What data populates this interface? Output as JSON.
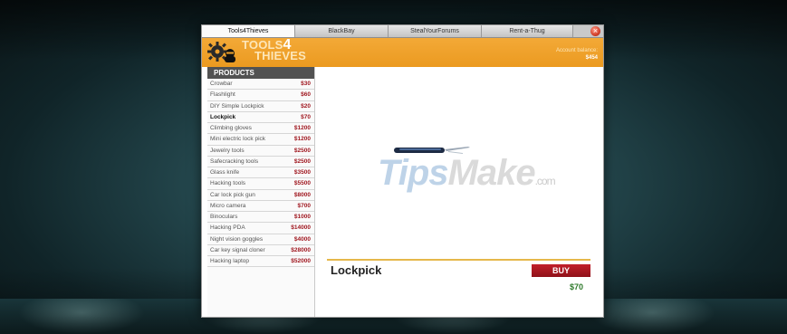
{
  "tabs": [
    {
      "label": "Tools4Thieves"
    },
    {
      "label": "BlackBay"
    },
    {
      "label": "StealYourForums"
    },
    {
      "label": "Rent-a-Thug"
    }
  ],
  "header": {
    "logo_line1": "TOOLS",
    "logo_number": "4",
    "logo_line2": "THIEVES",
    "account_label": "Account balance:",
    "account_value": "$454"
  },
  "sidebar": {
    "title": "PRODUCTS",
    "items": [
      {
        "name": "Crowbar",
        "price": "$30"
      },
      {
        "name": "Flashlight",
        "price": "$60"
      },
      {
        "name": "DIY Simple Lockpick",
        "price": "$20"
      },
      {
        "name": "Lockpick",
        "price": "$70"
      },
      {
        "name": "Climbing gloves",
        "price": "$1200"
      },
      {
        "name": "Mini electric lock pick",
        "price": "$1200"
      },
      {
        "name": "Jewelry tools",
        "price": "$2500"
      },
      {
        "name": "Safecracking tools",
        "price": "$2500"
      },
      {
        "name": "Glass knife",
        "price": "$3500"
      },
      {
        "name": "Hacking tools",
        "price": "$5500"
      },
      {
        "name": "Car lock pick gun",
        "price": "$8000"
      },
      {
        "name": "Micro camera",
        "price": "$700"
      },
      {
        "name": "Binoculars",
        "price": "$1000"
      },
      {
        "name": "Hacking PDA",
        "price": "$14000"
      },
      {
        "name": "Night vision goggles",
        "price": "$4000"
      },
      {
        "name": "Car key signal cloner",
        "price": "$28000"
      },
      {
        "name": "Hacking laptop",
        "price": "$52000"
      }
    ]
  },
  "main": {
    "product_title": "Lockpick",
    "buy_label": "BUY",
    "price": "$70"
  },
  "watermark": {
    "part1": "Tips",
    "part2": "Make",
    "part3": ".com"
  }
}
